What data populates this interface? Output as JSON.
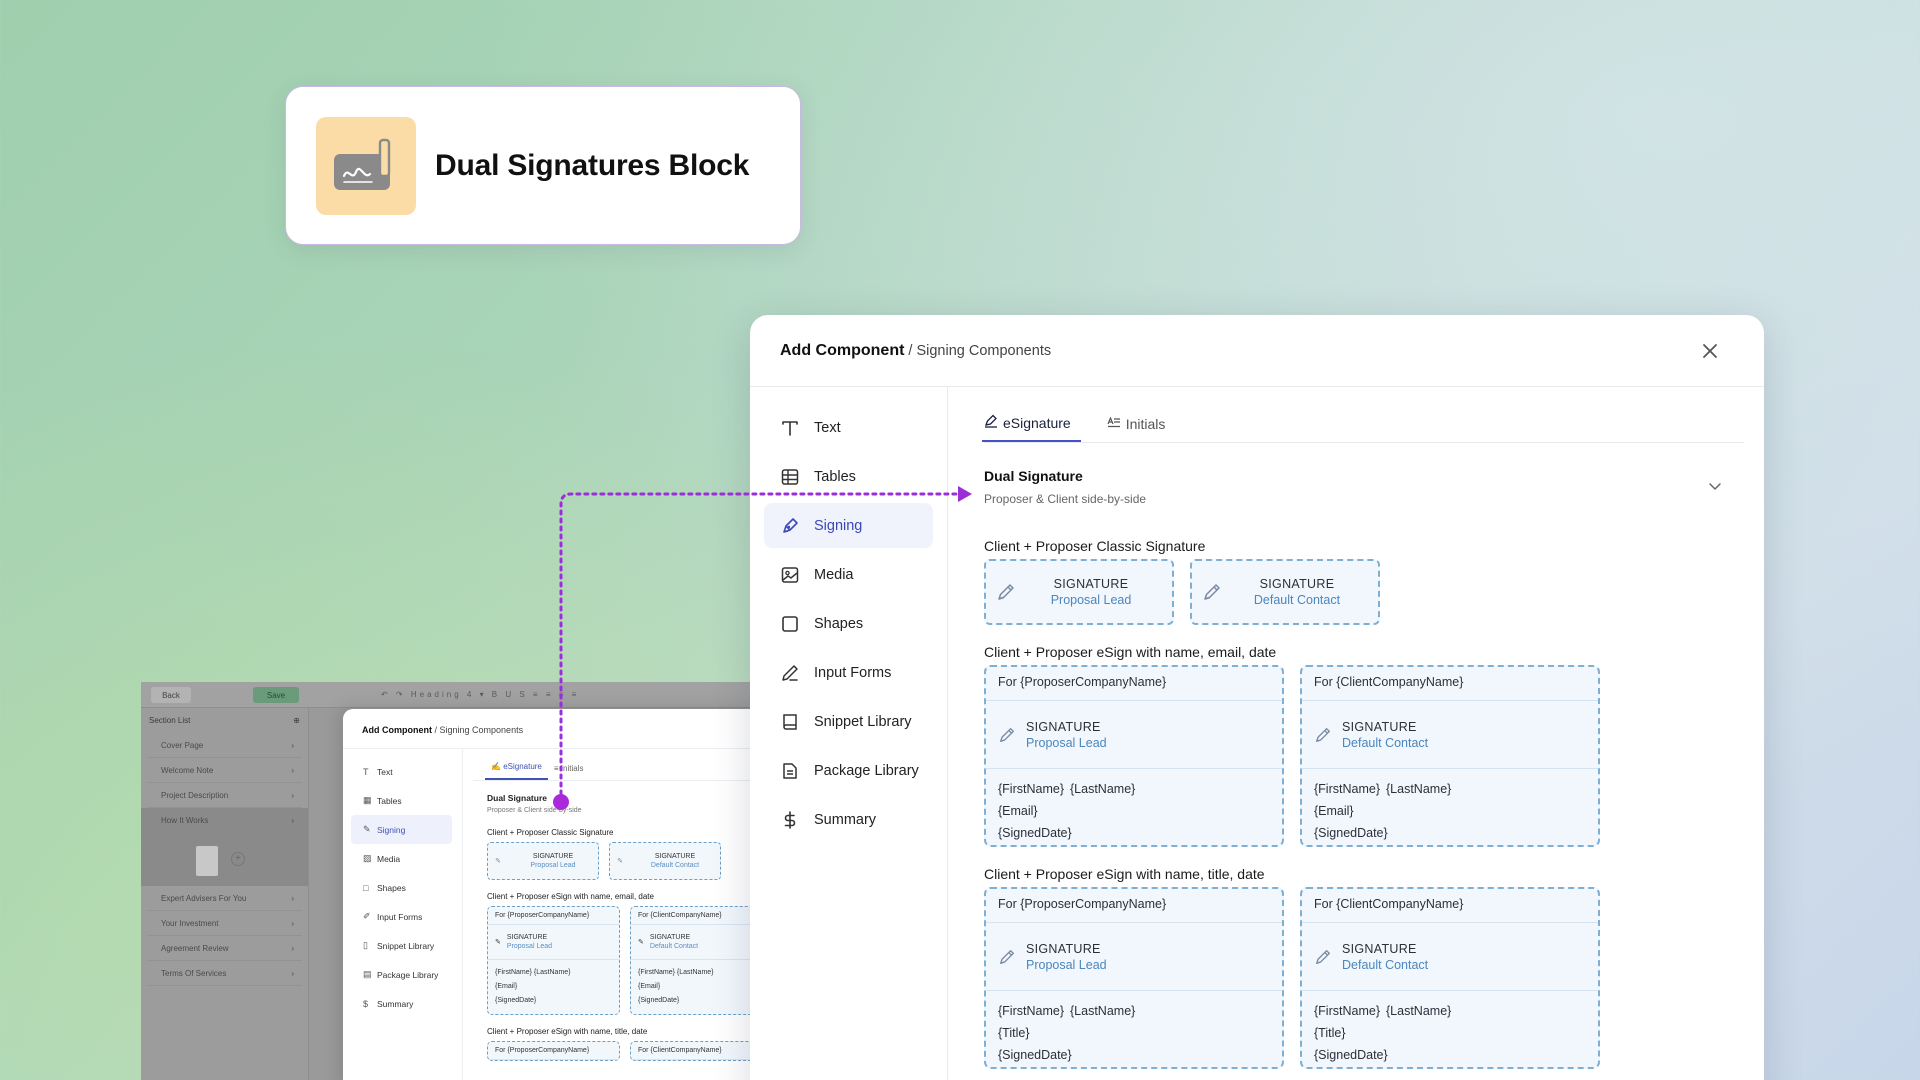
{
  "title_card": {
    "title": "Dual Signatures Block",
    "icon": "signature-pen-icon"
  },
  "mini_app": {
    "back_label": "Back",
    "save_label": "Save",
    "toolbar_heading": "Heading 4",
    "section_list_label": "Section List",
    "sections": [
      "Cover Page",
      "Welcome Note",
      "Project Description",
      "How It Works",
      "Expert Advisers For You",
      "Your Investment",
      "Agreement Review",
      "Terms Of Services"
    ],
    "modal": {
      "title": "Add Component",
      "crumb": "/ Signing Components",
      "nav": [
        "Text",
        "Tables",
        "Signing",
        "Media",
        "Shapes",
        "Input Forms",
        "Snippet Library",
        "Package Library",
        "Summary"
      ],
      "tabs": [
        "eSignature",
        "Initials"
      ],
      "dual_title": "Dual Signature",
      "dual_sub": "Proposer & Client side-by-side",
      "group1": "Client + Proposer Classic Signature",
      "group2": "Client + Proposer eSign with name, email, date",
      "group3": "Client + Proposer eSign with name, title, date"
    }
  },
  "modal": {
    "title": "Add Component",
    "breadcrumb": "/ Signing Components",
    "close_icon": "close-icon",
    "nav": [
      {
        "label": "Text",
        "icon": "text-icon"
      },
      {
        "label": "Tables",
        "icon": "table-icon"
      },
      {
        "label": "Signing",
        "icon": "signing-pen-icon",
        "active": true
      },
      {
        "label": "Media",
        "icon": "image-icon"
      },
      {
        "label": "Shapes",
        "icon": "square-icon"
      },
      {
        "label": "Input Forms",
        "icon": "pencil-icon"
      },
      {
        "label": "Snippet Library",
        "icon": "book-icon"
      },
      {
        "label": "Package Library",
        "icon": "document-icon"
      },
      {
        "label": "Summary",
        "icon": "dollar-icon"
      }
    ],
    "tabs": [
      {
        "label": "eSignature",
        "icon": "esignature-icon",
        "active": true
      },
      {
        "label": "Initials",
        "icon": "initials-icon"
      }
    ],
    "dual": {
      "title": "Dual Signature",
      "subtitle": "Proposer & Client side-by-side"
    },
    "groups": {
      "classic": {
        "title": "Client + Proposer Classic Signature",
        "items": [
          {
            "label": "SIGNATURE",
            "role": "Proposal Lead"
          },
          {
            "label": "SIGNATURE",
            "role": "Default Contact"
          }
        ]
      },
      "email": {
        "title": "Client + Proposer eSign with name, email, date",
        "cards": [
          {
            "head": "For {ProposerCompanyName}",
            "label": "SIGNATURE",
            "role": "Proposal Lead",
            "first": "{FirstName}",
            "last": "{LastName}",
            "field2": "{Email}",
            "date": "{SignedDate}"
          },
          {
            "head": "For {ClientCompanyName}",
            "label": "SIGNATURE",
            "role": "Default Contact",
            "first": "{FirstName}",
            "last": "{LastName}",
            "field2": "{Email}",
            "date": "{SignedDate}"
          }
        ]
      },
      "title": {
        "title": "Client + Proposer eSign with name, title, date",
        "cards": [
          {
            "head": "For {ProposerCompanyName}",
            "label": "SIGNATURE",
            "role": "Proposal Lead",
            "first": "{FirstName}",
            "last": "{LastName}",
            "field2": "{Title}",
            "date": "{SignedDate}"
          },
          {
            "head": "For {ClientCompanyName}",
            "label": "SIGNATURE",
            "role": "Default Contact",
            "first": "{FirstName}",
            "last": "{LastName}",
            "field2": "{Title}",
            "date": "{SignedDate}"
          }
        ]
      }
    }
  },
  "colors": {
    "accent": "#3b49b8",
    "connector": "#9b2fd6",
    "sig_border": "#7fb0d4",
    "title_icon_bg": "#fbdca6"
  }
}
